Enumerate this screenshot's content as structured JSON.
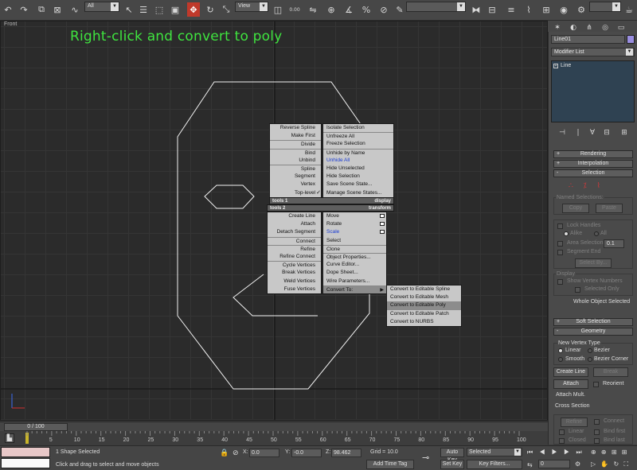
{
  "toolbar": {
    "selection_filter": "All",
    "reference_coord": "View",
    "snap_value": "0.00",
    "named_selection": ""
  },
  "viewport": {
    "label": "Front",
    "instruction": "Right-click and convert to poly"
  },
  "quad_menu": {
    "tools1_header": "tools 1",
    "tools2_header": "tools 2",
    "display_header": "display",
    "transform_header": "transform",
    "tools1_items": [
      "Reverse Spline",
      "Make First",
      "Divide",
      "Bind",
      "Unbind",
      "Spline",
      "Segment",
      "Vertex",
      "Top-level"
    ],
    "display_items": [
      "Isolate Selection",
      "Unfreeze All",
      "Freeze Selection",
      "Unhide by Name",
      "Unhide All",
      "Hide Unselected",
      "Hide Selection",
      "Save Scene State...",
      "Manage Scene States..."
    ],
    "tools2_items": [
      "Create Line",
      "Attach",
      "Detach Segment",
      "Connect",
      "Refine",
      "Refine Connect",
      "Cycle Vertices",
      "Break Vertices",
      "Weld Vertices",
      "Fuse Vertices"
    ],
    "transform_items": [
      "Move",
      "Rotate",
      "Scale",
      "Select",
      "Clone",
      "Object Properties...",
      "Curve Editor...",
      "Dope Sheet...",
      "Wire Parameters...",
      "Convert To:"
    ],
    "convert_items": [
      "Convert to Editable Spline",
      "Convert to Editable Mesh",
      "Convert to Editable Poly",
      "Convert to Editable Patch",
      "Convert to NURBS"
    ],
    "checkmark": "✓",
    "submenu_arrow": "▶"
  },
  "command_panel": {
    "object_name": "Line01",
    "modifier_list": "Modifier List",
    "stack_item": "Line",
    "rollouts": {
      "rendering": "Rendering",
      "interpolation": "Interpolation",
      "selection": "Selection",
      "soft_selection": "Soft Selection",
      "geometry": "Geometry"
    },
    "named_selections": "Named Selections:",
    "copy": "Copy",
    "paste": "Paste",
    "lock_handles": "Lock Handles",
    "alike": "Alike",
    "all": "All",
    "area_selection": "Area Selection:",
    "area_value": "0.1",
    "segment_end": "Segment End",
    "select_by": "Select By...",
    "display": "Display",
    "show_vertex_numbers": "Show Vertex Numbers",
    "selected_only": "Selected Only",
    "whole_object_selected": "Whole Object Selected",
    "new_vertex_type": "New Vertex Type",
    "linear": "Linear",
    "bezier": "Bezier",
    "smooth": "Smooth",
    "bezier_corner": "Bezier Corner",
    "create_line": "Create Line",
    "break": "Break",
    "attach": "Attach",
    "reorient": "Reorient",
    "attach_mult": "Attach Mult.",
    "cross_section": "Cross Section",
    "refine": "Refine",
    "connect": "Connect",
    "linear2": "Linear",
    "bind_first": "Bind first",
    "closed": "Closed",
    "bind_last": "Bind last"
  },
  "timeline": {
    "frame_display": "0 / 100",
    "ticks": [
      "0",
      "5",
      "10",
      "15",
      "20",
      "25",
      "30",
      "35",
      "40",
      "45",
      "50",
      "55",
      "60",
      "65",
      "70",
      "75",
      "80",
      "85",
      "90",
      "95",
      "100"
    ]
  },
  "status": {
    "selection_info": "1 Shape Selected",
    "prompt": "Click and drag to select and move objects",
    "x_label": "X:",
    "x_value": "0.0",
    "y_label": "Y:",
    "y_value": "-0.0",
    "z_label": "Z:",
    "z_value": "98.462",
    "grid": "Grid = 10.0",
    "add_time_tag": "Add Time Tag",
    "auto_key": "Auto Key",
    "set_key": "Set Key",
    "key_mode": "Selected",
    "key_filters": "Key Filters...",
    "current_frame": "0"
  }
}
